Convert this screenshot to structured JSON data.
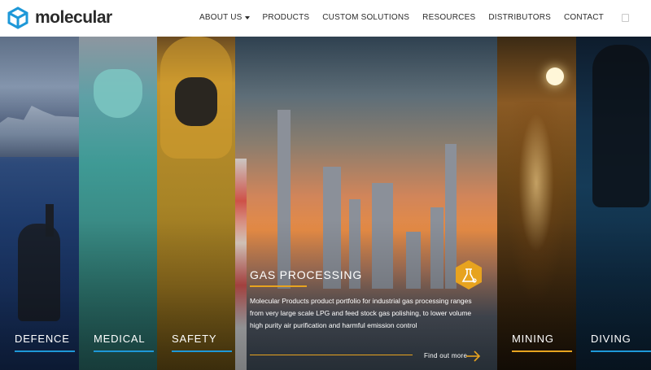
{
  "brand": {
    "name": "molecular",
    "logo_icon": "cube-logo-icon",
    "accent_color": "#1e98d8"
  },
  "nav": {
    "items": [
      {
        "label": "ABOUT US",
        "has_dropdown": true
      },
      {
        "label": "PRODUCTS",
        "has_dropdown": false
      },
      {
        "label": "CUSTOM SOLUTIONS",
        "has_dropdown": false
      },
      {
        "label": "RESOURCES",
        "has_dropdown": false
      },
      {
        "label": "DISTRIBUTORS",
        "has_dropdown": false
      },
      {
        "label": "CONTACT",
        "has_dropdown": false
      }
    ],
    "search_icon": "search-icon"
  },
  "panels": [
    {
      "key": "defence",
      "label": "DEFENCE",
      "underline_color": "#1e98d8"
    },
    {
      "key": "medical",
      "label": "MEDICAL",
      "underline_color": "#1e98d8"
    },
    {
      "key": "safety",
      "label": "SAFETY",
      "underline_color": "#1e98d8"
    },
    {
      "key": "gas",
      "label": "GAS PROCESSING",
      "underline_color": "#e7a31f"
    },
    {
      "key": "mining",
      "label": "MINING",
      "underline_color": "#e7a31f"
    },
    {
      "key": "diving",
      "label": "DIVING",
      "underline_color": "#1e98d8"
    }
  ],
  "featured": {
    "title": "GAS PROCESSING",
    "description": "Molecular Products product portfolio for industrial gas processing ranges from very large scale LPG and feed stock gas polishing, to lower volume high purity air purification and harmful emission control",
    "cta_label": "Find out more",
    "icon": "gas-flask-hex-icon",
    "icon_color": "#e7a31f"
  }
}
